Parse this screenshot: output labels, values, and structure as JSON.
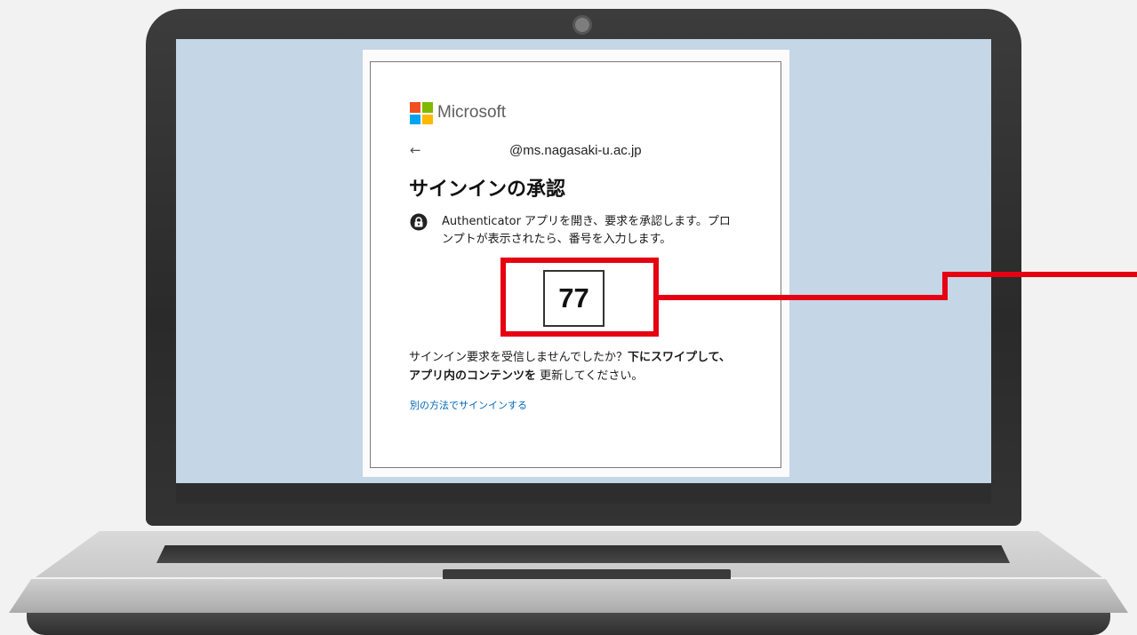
{
  "brand": {
    "name": "Microsoft",
    "colors": [
      "#f25022",
      "#7fba00",
      "#00a4ef",
      "#ffb900"
    ]
  },
  "signin": {
    "account": "@ms.nagasaki-u.ac.jp",
    "back_icon": "←",
    "title": "サインインの承認",
    "instructions_line1": "Authenticator アプリを開き、要求を承認します。プロ",
    "instructions_line2": "ンプトが表示されたら、番号を入力します。",
    "number": "77",
    "not_received_text": "サインイン要求を受信しませんでしたか？",
    "not_received_bold1": "下にスワイプして、",
    "not_received_bold2": "アプリ内のコンテンツを",
    "not_received_tail": " 更新してください。",
    "other_method_link": "別の方法でサインインする"
  },
  "annotation": {
    "highlight_color": "#e60012"
  },
  "icons": {
    "back": "back-arrow-icon",
    "authenticator": "authenticator-lock-icon",
    "camera": "webcam-icon"
  }
}
